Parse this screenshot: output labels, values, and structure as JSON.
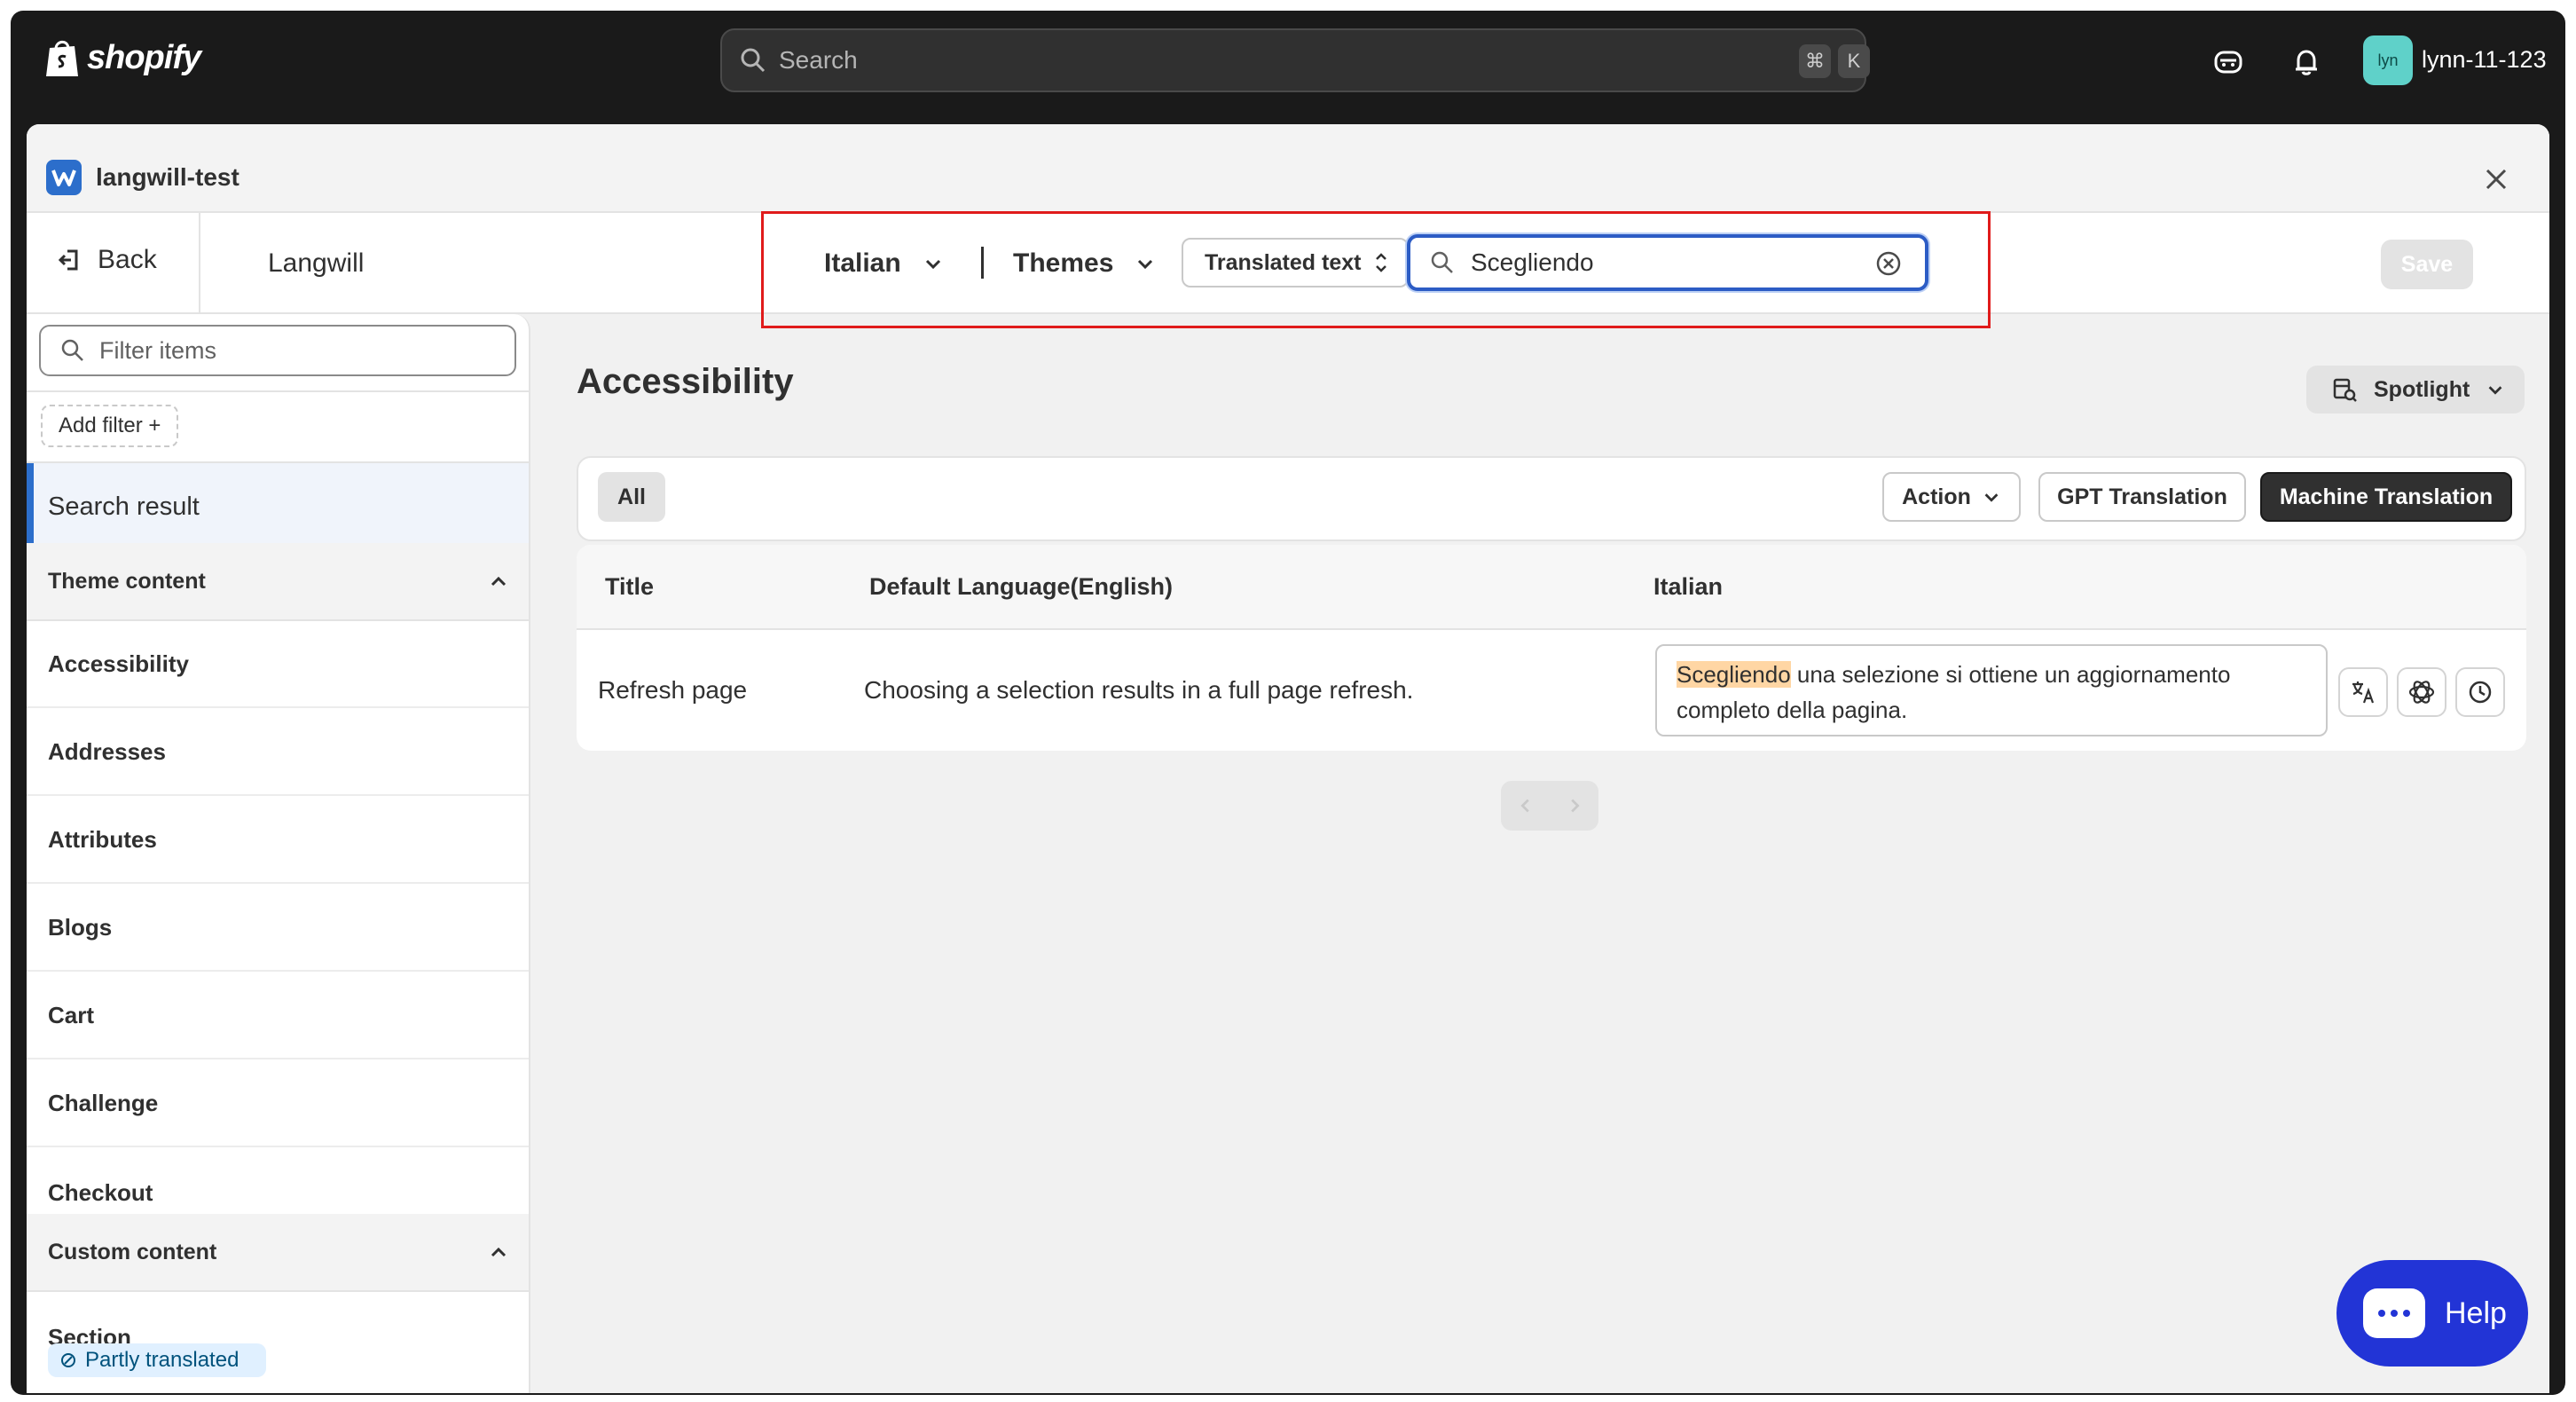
{
  "topbar": {
    "logo_text": "shopify",
    "search_placeholder": "Search",
    "shortcut_cmd": "⌘",
    "shortcut_key": "K",
    "avatar_initials": "lyn",
    "username": "lynn-11-123"
  },
  "modal": {
    "app_title": "langwill-test",
    "back_label": "Back",
    "app_name": "Langwill",
    "language": "Italian",
    "resource_type": "Themes",
    "filter_mode": "Translated text",
    "search_value": "Scegliendo",
    "save_label": "Save"
  },
  "sidebar": {
    "filter_placeholder": "Filter items",
    "add_filter_label": "Add filter +",
    "active_item": "Search result",
    "theme_group": "Theme content",
    "theme_items": [
      "Accessibility",
      "Addresses",
      "Attributes",
      "Blogs",
      "Cart",
      "Challenge",
      "Checkout"
    ],
    "custom_group": "Custom content",
    "custom_items": [
      "Section"
    ],
    "section_badge": "Partly translated"
  },
  "main": {
    "title": "Accessibility",
    "spotlight_label": "Spotlight",
    "filter_all": "All",
    "action_label": "Action",
    "gpt_label": "GPT Translation",
    "machine_label": "Machine Translation",
    "columns": [
      "Title",
      "Default Language(English)",
      "Italian"
    ],
    "row": {
      "title": "Refresh page",
      "default": "Choosing a selection results in a full page refresh.",
      "highlight": "Scegliendo",
      "translation_rest": " una selezione si ottiene un aggiornamento completo della pagina."
    }
  },
  "help_label": "Help",
  "colors": {
    "accent": "#2c6ecb",
    "highlight_box": "#e01b1b",
    "help": "#2234d6",
    "match_highlight": "#ffd6a4"
  }
}
